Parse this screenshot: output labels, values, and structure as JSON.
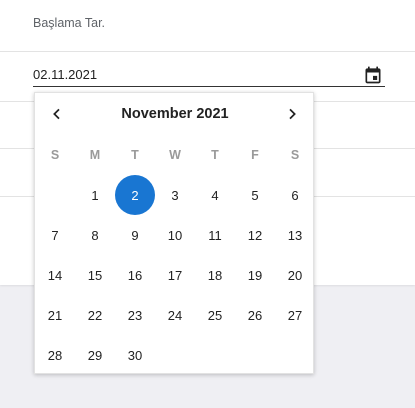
{
  "form": {
    "field_label": "Başlama Tar.",
    "date_value": "02.11.2021"
  },
  "datepicker": {
    "month_title": "November 2021",
    "prev_icon": "chevron-left-icon",
    "next_icon": "chevron-right-icon",
    "calendar_icon": "calendar-icon",
    "weekdays": [
      "S",
      "M",
      "T",
      "W",
      "T",
      "F",
      "S"
    ],
    "weeks": [
      [
        "",
        "1",
        "2",
        "3",
        "4",
        "5",
        "6"
      ],
      [
        "7",
        "8",
        "9",
        "10",
        "11",
        "12",
        "13"
      ],
      [
        "14",
        "15",
        "16",
        "17",
        "18",
        "19",
        "20"
      ],
      [
        "21",
        "22",
        "23",
        "24",
        "25",
        "26",
        "27"
      ],
      [
        "28",
        "29",
        "30",
        "",
        "",
        "",
        ""
      ]
    ],
    "selected_day": "2",
    "accent_color": "#1976d2"
  }
}
